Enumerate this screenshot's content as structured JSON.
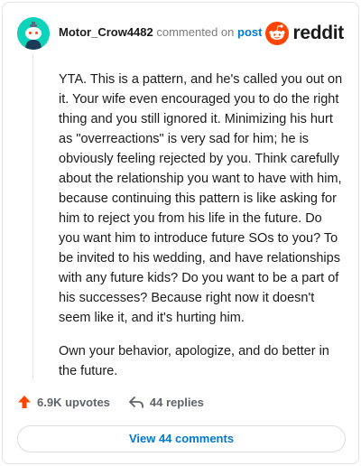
{
  "comment": {
    "username": "Motor_Crow4482",
    "action_text": "commented on",
    "target_link": "post",
    "paragraphs": [
      "YTA. This is a pattern, and he's called you out on it. Your wife even encouraged you to do the right thing and you still ignored it. Minimizing his hurt as \"overreactions\" is very sad for him; he is obviously feeling rejected by you. Think carefully about the relationship you want to have with him, because continuing this pattern is like asking for him to reject you from his life in the future. Do you want him to introduce future SOs to you? To be invited to his wedding, and have relationships with any future kids? Do you want to be a part of his successes? Because right now it doesn't seem like it, and it's hurting him.",
      "Own your behavior, apologize, and do better in the future."
    ],
    "upvotes": "6.9K upvotes",
    "replies": "44 replies",
    "view_button": "View 44 comments"
  },
  "brand": {
    "wordmark": "reddit",
    "icon": "reddit-snoo-icon"
  },
  "icons": {
    "avatar": "snoo-avatar-icon",
    "upvote": "upvote-arrow-icon",
    "reply": "reply-arrow-icon"
  },
  "colors": {
    "accent": "#0079d3",
    "brand": "#ff4500",
    "avatar_bg": "#0dd3bb"
  }
}
